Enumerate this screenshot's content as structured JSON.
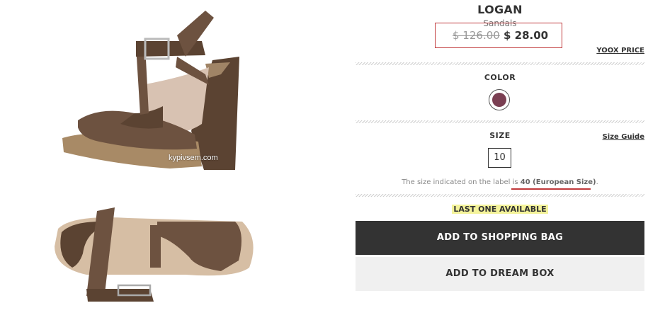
{
  "product": {
    "brand": "LOGAN",
    "category": "Sandals",
    "old_price": "$ 126.00",
    "new_price": "$ 28.00",
    "yoox_price_link": "YOOX PRICE",
    "watermark": "kypivsem.com"
  },
  "color": {
    "label": "COLOR",
    "swatch_color": "#7a3f52"
  },
  "size": {
    "label": "SIZE",
    "guide_link": "Size Guide",
    "selected": "10",
    "note_prefix": "The size indicated on the label is ",
    "note_value": "40 (European Size)",
    "note_suffix": "."
  },
  "stock": {
    "notice": "LAST ONE AVAILABLE"
  },
  "actions": {
    "add_to_bag": "ADD TO SHOPPING BAG",
    "add_to_dream": "ADD TO DREAM BOX"
  },
  "colors": {
    "primary_button": "#333333",
    "secondary_button": "#f0f0f0",
    "highlight": "#f4f39a",
    "accent_red": "#c0393b"
  }
}
